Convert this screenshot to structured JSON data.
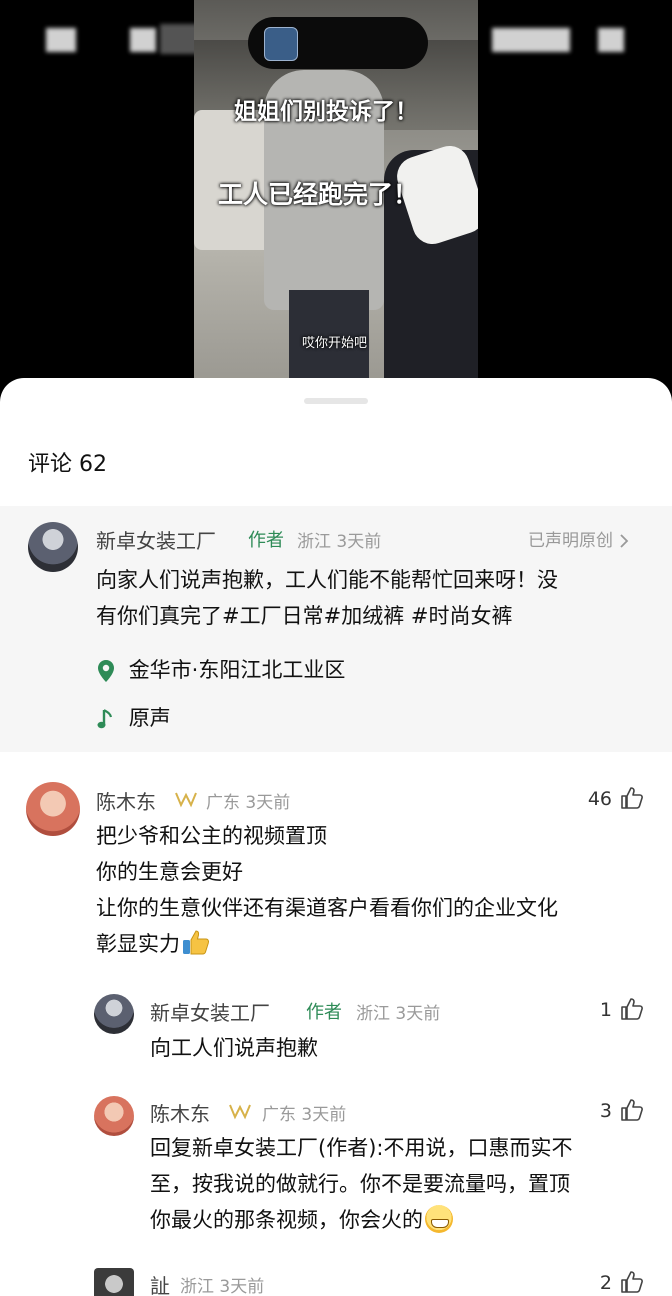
{
  "video": {
    "overlay_line1": "姐姐们别投诉了！",
    "overlay_line2": "工人已经跑完了！",
    "caption": "哎你开始吧"
  },
  "comments_header": {
    "label": "评论",
    "count": "62"
  },
  "post": {
    "author": "新卓女装工厂",
    "author_tag": "作者",
    "region": "浙江",
    "time": "3天前",
    "declared": "已声明原创",
    "text_line1": "向家人们说声抱歉，工人们能不能帮忙回来呀！没",
    "text_line2": "有你们真完了#工厂日常#加绒裤 #时尚女裤",
    "location": "金华市·东阳江北工业区",
    "music": "原声"
  },
  "comments": [
    {
      "author": "陈木东",
      "region": "广东",
      "time": "3天前",
      "likes": "46",
      "lines": [
        "把少爷和公主的视频置顶",
        "你的生意会更好",
        "让你的生意伙伴还有渠道客户看看你们的企业文化",
        "彰显实力"
      ]
    },
    {
      "author": "新卓女装工厂",
      "author_tag": "作者",
      "region": "浙江",
      "time": "3天前",
      "likes": "1",
      "text": "向工人们说声抱歉"
    },
    {
      "author": "陈木东",
      "region": "广东",
      "time": "3天前",
      "likes": "3",
      "lines": [
        "回复新卓女装工厂(作者):不用说，口惠而实不",
        "至，按我说的做就行。你不是要流量吗，置顶",
        "你最火的那条视频，你会火的"
      ]
    },
    {
      "author": "訨",
      "region": "浙江",
      "time": "3天前",
      "likes": "2"
    }
  ],
  "colors": {
    "author_tag": "#2e8b57",
    "meta": "#9a9a9a",
    "post_bg": "#f6f6f6",
    "location_pin": "#2e8b57"
  },
  "icons": [
    "location-pin-icon",
    "music-note-icon",
    "like-icon",
    "chevron-right-icon",
    "crown-badge-icon"
  ]
}
